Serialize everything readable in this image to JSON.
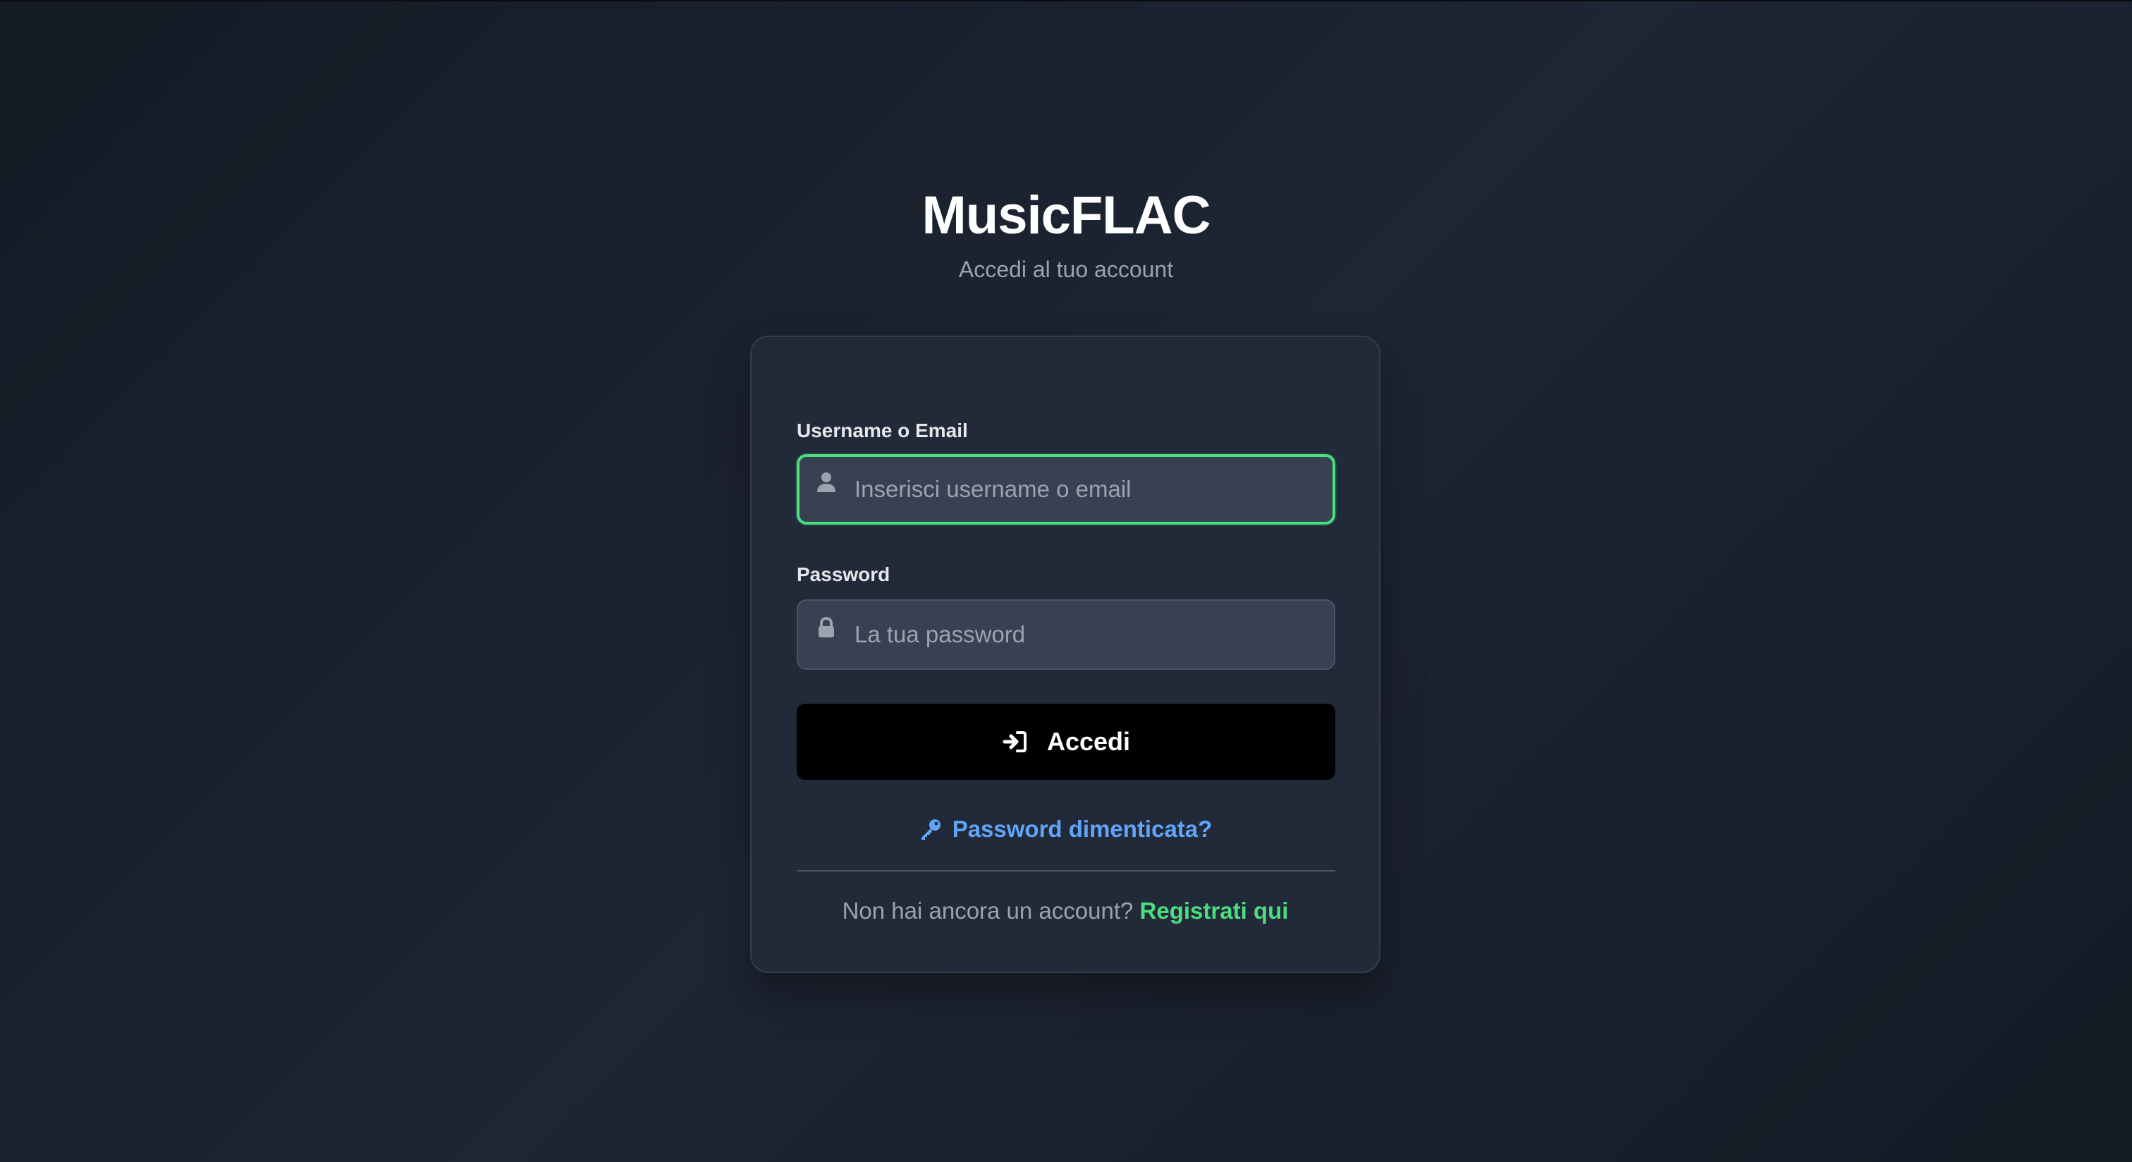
{
  "app": {
    "title": "MusicFLAC",
    "subtitle": "Accedi al tuo account"
  },
  "form": {
    "username": {
      "label": "Username o Email",
      "placeholder": "Inserisci username o email",
      "value": "",
      "icon": "user-icon",
      "focused": true
    },
    "password": {
      "label": "Password",
      "placeholder": "La tua password",
      "value": "",
      "icon": "lock-icon"
    },
    "submit": {
      "label": "Accedi",
      "icon": "sign-in-icon"
    },
    "forgot": {
      "label": "Password dimenticata?",
      "icon": "key-icon"
    },
    "register": {
      "prompt": "Non hai ancora un account?",
      "link": "Registrati qui"
    }
  },
  "colors": {
    "accent_green": "#4ade80",
    "link_blue": "#60a5fa",
    "background": "#1b2230",
    "card": "#222938",
    "button": "#000000"
  }
}
